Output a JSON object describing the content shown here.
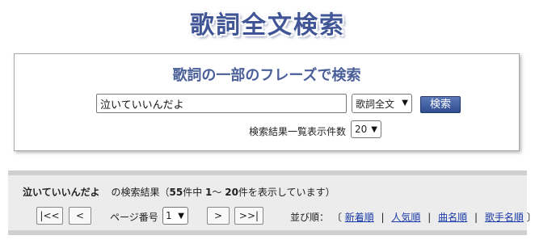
{
  "site_title": "歌詞全文検索",
  "search": {
    "heading": "歌詞の一部のフレーズで検索",
    "query": "泣いていいんだよ",
    "mode": "歌詞全文",
    "button": "検索",
    "count_label": "検索結果一覧表示件数",
    "count_value": "20"
  },
  "results": {
    "query": "泣いていいんだよ",
    "t1": "の検索結果（",
    "total": "55",
    "t2": "件中 ",
    "start": "1",
    "t3": "～ ",
    "end": "20",
    "t4": "件を表示しています）"
  },
  "pagination": {
    "first": "|<<",
    "prev": "<",
    "page_label": "ページ番号",
    "page": "1",
    "next": ">",
    "last": ">>|"
  },
  "sort": {
    "label": "並び順：",
    "open": "〔",
    "options": [
      "新着順",
      "人気順",
      "曲名順",
      "歌手名順"
    ],
    "sep": "|",
    "close": "〕"
  }
}
